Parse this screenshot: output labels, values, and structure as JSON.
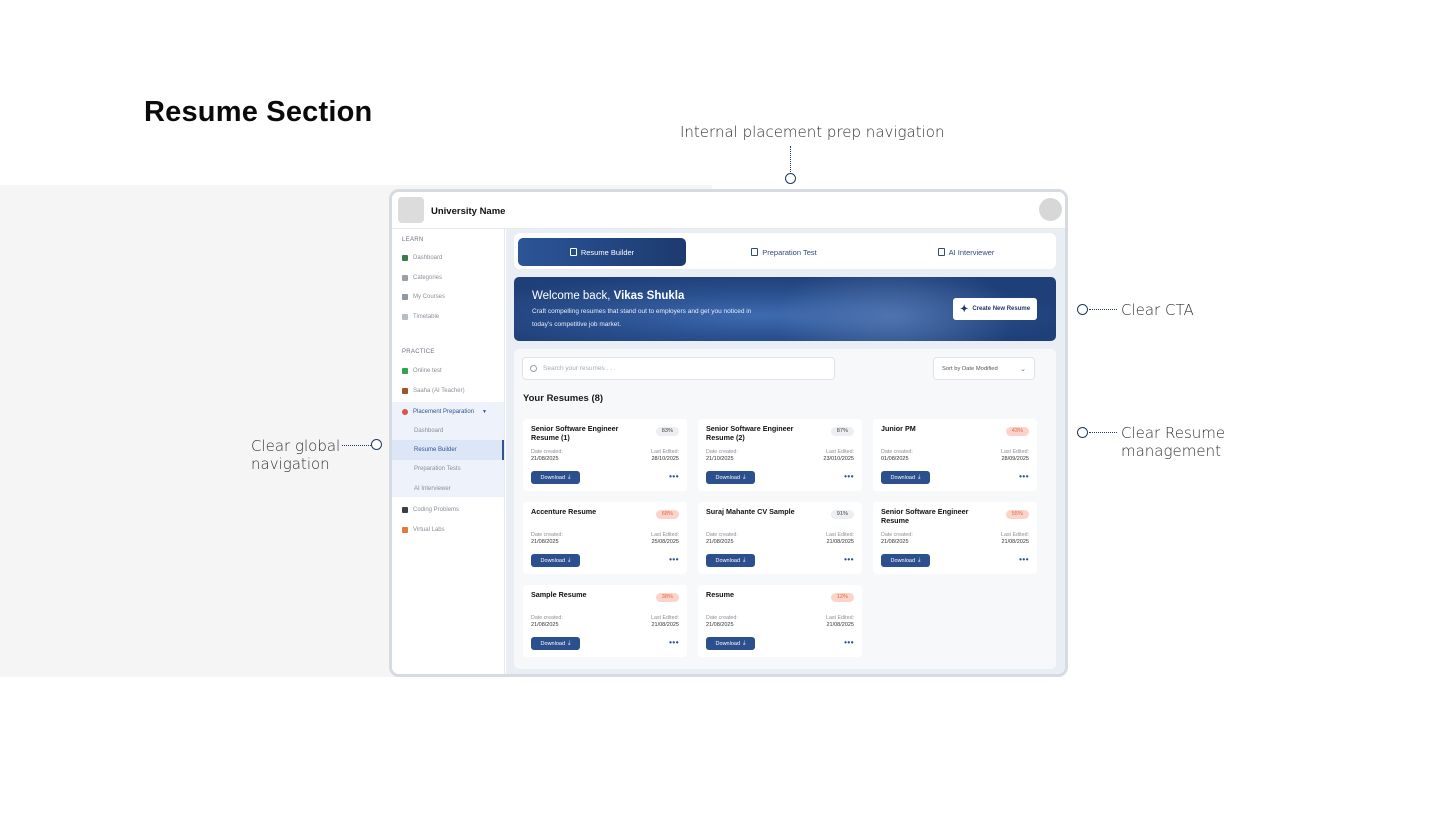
{
  "page_title": "Resume Section",
  "annotations": {
    "top": "Internal placement prep navigation",
    "cta": "Clear CTA",
    "management_line1": "Clear Resume",
    "management_line2": "management",
    "nav_line1": "Clear global",
    "nav_line2": "navigation"
  },
  "topbar": {
    "university_name": "University Name"
  },
  "sidebar": {
    "learn_heading": "LEARN",
    "learn_items": [
      {
        "label": "Dashboard",
        "icon": "chart-icon"
      },
      {
        "label": "Categories",
        "icon": "folder-icon"
      },
      {
        "label": "My Courses",
        "icon": "book-icon"
      },
      {
        "label": "Timetable",
        "icon": "calendar-icon"
      }
    ],
    "practice_heading": "PRACTICE",
    "practice_items": [
      {
        "label": "Online test",
        "icon": "check-icon"
      },
      {
        "label": "Saaha (AI Teacher)",
        "icon": "teacher-icon"
      },
      {
        "label": "Placement Preparation",
        "icon": "target-icon"
      }
    ],
    "placement_sub_items": [
      {
        "label": "Dashboard"
      },
      {
        "label": "Resume Builder"
      },
      {
        "label": "Preparation Tests"
      },
      {
        "label": "AI Interviewer"
      }
    ],
    "other_items": [
      {
        "label": "Coding Problems",
        "icon": "laptop-icon"
      },
      {
        "label": "Virtual Labs",
        "icon": "rocket-icon"
      }
    ]
  },
  "tabs": [
    {
      "label": "Resume Builder",
      "icon": "document-icon"
    },
    {
      "label": "Preparation Test",
      "icon": "clipboard-icon"
    },
    {
      "label": "AI Interviewer",
      "icon": "robot-icon"
    }
  ],
  "hero": {
    "welcome": "Welcome back,",
    "user_name": "Vikas Shukla",
    "description": "Craft compelling resumes that stand out to employers and get you noticed in today's competitive job market.",
    "cta_label": "Create New Resume"
  },
  "search": {
    "placeholder": "Search your resumes . . ."
  },
  "sort": {
    "selected": "Sort by Date Modified"
  },
  "resumes_heading": "Your Resumes (8)",
  "card_labels": {
    "date_created": "Date created:",
    "last_edited": "Last Edited:",
    "download": "Download"
  },
  "resumes": [
    {
      "title": "Senior Software Engineer Resume (1)",
      "score": "83%",
      "status": "good",
      "created": "21/08/2025",
      "edited": "28/10/2025"
    },
    {
      "title": "Senior Software Engineer Resume (2)",
      "score": "87%",
      "status": "good",
      "created": "21/10/2025",
      "edited": "23/010/2025"
    },
    {
      "title": "Junior PM",
      "score": "43%",
      "status": "bad",
      "created": "01/08/2025",
      "edited": "28/09/2025"
    },
    {
      "title": "Accenture Resume",
      "score": "68%",
      "status": "bad",
      "created": "21/08/2025",
      "edited": "25/08/2025"
    },
    {
      "title": "Suraj Mahante CV Sample",
      "score": "91%",
      "status": "good",
      "created": "21/08/2025",
      "edited": "21/08/2025"
    },
    {
      "title": "Senior Software Engineer Resume",
      "score": "55%",
      "status": "bad",
      "created": "21/08/2025",
      "edited": "21/08/2025"
    },
    {
      "title": "Sample Resume",
      "score": "38%",
      "status": "bad",
      "created": "21/08/2025",
      "edited": "21/08/2025"
    },
    {
      "title": "Resume",
      "score": "12%",
      "status": "bad",
      "created": "21/08/2025",
      "edited": "21/08/2025"
    }
  ],
  "colors": {
    "primary": "#2c4f8e",
    "score_good_bg": "#eceef2",
    "score_bad_bg": "#fbd3c9",
    "score_bad_text": "#e0694d"
  }
}
